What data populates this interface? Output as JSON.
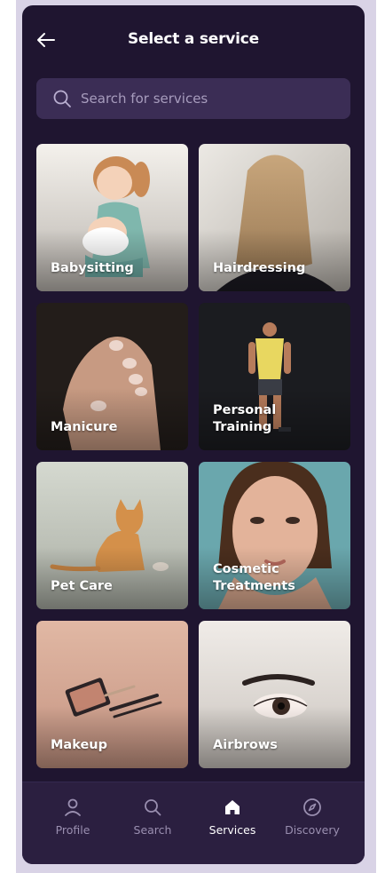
{
  "header": {
    "title": "Select a service"
  },
  "search": {
    "placeholder": "Search for services"
  },
  "services": [
    {
      "label": "Babysitting"
    },
    {
      "label": "Hairdressing"
    },
    {
      "label": "Manicure"
    },
    {
      "label": "Personal Training"
    },
    {
      "label": "Pet Care"
    },
    {
      "label": "Cosmetic Treatments"
    },
    {
      "label": "Makeup"
    },
    {
      "label": "Airbrows"
    }
  ],
  "nav": {
    "items": [
      {
        "label": "Profile",
        "icon": "person-icon"
      },
      {
        "label": "Search",
        "icon": "search-icon"
      },
      {
        "label": "Services",
        "icon": "home-icon",
        "active": true
      },
      {
        "label": "Discovery",
        "icon": "compass-icon"
      }
    ]
  },
  "colors": {
    "background": "#1f1530",
    "search_bg": "#3b2d55",
    "nav_bg": "#2b1f40",
    "inactive_nav": "#9a8fb0",
    "active_nav": "#ffffff"
  }
}
